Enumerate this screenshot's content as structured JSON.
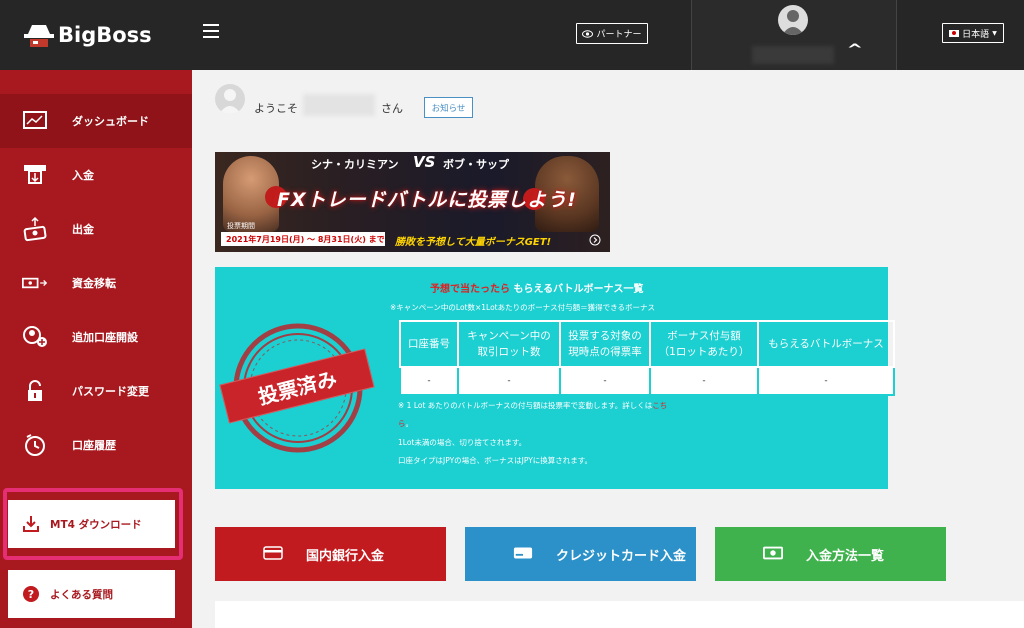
{
  "header": {
    "logo_text": "BigBoss",
    "partner_label": "パートナー",
    "language_label": "日本語"
  },
  "sidebar": {
    "items": [
      {
        "label": "ダッシュボード",
        "icon": "dashboard-icon"
      },
      {
        "label": "入金",
        "icon": "deposit-icon"
      },
      {
        "label": "出金",
        "icon": "withdraw-icon"
      },
      {
        "label": "資金移転",
        "icon": "transfer-icon"
      },
      {
        "label": "追加口座開設",
        "icon": "add-account-icon"
      },
      {
        "label": "パスワード変更",
        "icon": "lock-icon"
      },
      {
        "label": "口座履歴",
        "icon": "history-icon"
      }
    ],
    "mt4_label": "MT4 ダウンロード",
    "faq_label": "よくある質問"
  },
  "welcome": {
    "prefix": "ようこそ",
    "suffix": "さん",
    "notice_label": "お知らせ"
  },
  "banner": {
    "top_left": "シナ・カリミアン",
    "vs": "VS",
    "top_right": "ボブ・サップ",
    "main": "FXトレードバトルに投票しよう!",
    "period_label": "投票期間",
    "dates": "2021年7月19日(月) 〜 8月31日(火) まで",
    "cta": "勝敗を予想して大量ボーナスGET!"
  },
  "bonus": {
    "title_red": "予想で当たったら",
    "title_white": "もらえるバトルボーナス一覧",
    "subtitle": "※キャンペーン中のLot数×1Lotあたりのボーナス付与額＝獲得できるボーナス",
    "stamp_label": "投票済み",
    "columns": [
      "口座番号",
      "キャンペーン中の取引ロット数",
      "投票する対象の現時点の得票率",
      "ボーナス付与額（1ロットあたり）",
      "もらえるバトルボーナス"
    ],
    "column_lines": [
      [
        "口座番号"
      ],
      [
        "キャンペーン中の",
        "取引ロット数"
      ],
      [
        "投票する対象の",
        "現時点の得票率"
      ],
      [
        "ボーナス付与額",
        "（1ロットあたり）"
      ],
      [
        "もらえるバトルボーナス"
      ]
    ],
    "row": [
      "-",
      "-",
      "-",
      "-",
      "-"
    ],
    "note1_a": "※ 1 Lot あたりのバトルボーナスの付与額は投票率で変動します。詳しくは",
    "note1_link_a": "こち",
    "note1_link_b": "ら",
    "note1_b": "。",
    "note2": "1Lot未満の場合、切り捨てされます。",
    "note3": "口座タイプはJPYの場合、ボーナスはJPYに換算されます。"
  },
  "actions": {
    "bank_label": "国内銀行入金",
    "card_label": "クレジットカード入金",
    "method_label": "入金方法一覧"
  },
  "colors": {
    "sidebar": "#a8191f",
    "topbar": "#262626",
    "cyan": "#1ccfd1",
    "bank": "#c11b1f",
    "card": "#2b91c8",
    "method": "#3fb24d",
    "highlight": "#e62e74"
  }
}
